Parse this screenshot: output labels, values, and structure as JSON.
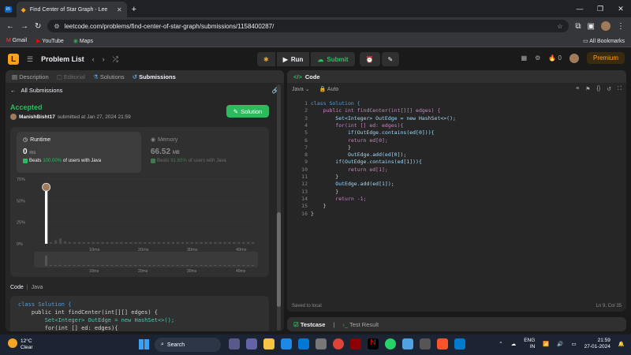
{
  "browser": {
    "tab1_icon": "linkedin-icon",
    "tab_title": "Find Center of Star Graph - Lee",
    "url": "leetcode.com/problems/find-center-of-star-graph/submissions/1158400287/",
    "bookmarks": [
      "Gmail",
      "YouTube",
      "Maps"
    ],
    "all_bookmarks": "All Bookmarks"
  },
  "header": {
    "problem_list": "Problem List",
    "run": "Run",
    "submit": "Submit",
    "streak": "0",
    "premium": "Premium"
  },
  "left": {
    "tabs": [
      "Description",
      "Editorial",
      "Solutions",
      "Submissions"
    ],
    "all_submissions": "All Submissions",
    "status": "Accepted",
    "user": "ManishBisht17",
    "submitted": "submitted at Jan 27, 2024 21:59",
    "solution_btn": "Solution",
    "runtime_label": "Runtime",
    "runtime_value": "0",
    "runtime_unit": "ms",
    "runtime_beats_pre": "Beats",
    "runtime_beats": "100.00%",
    "runtime_beats_post": "of users with Java",
    "memory_label": "Memory",
    "memory_value": "66.52",
    "memory_unit": "MB",
    "memory_beats_pre": "Beats",
    "memory_beats": "91.65%",
    "memory_beats_post": "of users with Java",
    "code_label": "Code",
    "code_lang": "Java",
    "code_lines": [
      "class Solution {",
      "    public int findCenter(int[][] edges) {",
      "        Set<Integer> OutEdge = new HashSet<>();",
      "        for(int [] ed: edges){"
    ]
  },
  "chart_data": {
    "type": "bar",
    "yticks": [
      "75%",
      "50%",
      "25%",
      "0%"
    ],
    "xticks": [
      "10ms",
      "20ms",
      "30ms",
      "40ms"
    ],
    "ylim": [
      0,
      75
    ],
    "values": [
      62,
      2,
      4,
      6,
      3,
      2,
      2,
      2,
      2,
      2,
      2,
      2,
      2,
      2,
      2,
      2,
      2,
      2,
      2,
      2,
      2,
      2,
      2,
      2,
      2,
      2,
      2,
      2,
      2,
      2,
      2,
      2,
      2,
      2,
      2,
      2,
      2,
      2,
      2,
      2,
      2,
      2,
      2,
      2,
      2
    ],
    "highlight_index": 0,
    "colors": {
      "highlight": "#ffffff",
      "bars": "#4a4a4a"
    }
  },
  "right": {
    "title": "Code",
    "lang": "Java",
    "auto": "Auto",
    "code": [
      "class Solution {",
      "    public int findCenter(int[][] edges) {",
      "        Set<Integer> OutEdge = new HashSet<>();",
      "        for(int [] ed: edges){",
      "            if(OutEdge.contains(ed[0])){",
      "            return ed[0];",
      "            }",
      "            OutEdge.add(ed[0]);",
      "        if(OutEdge.contains(ed[1])){",
      "            return ed[1];",
      "        }",
      "        OutEdge.add(ed[1]);",
      "        }",
      "        return -1;",
      "    }",
      "}"
    ],
    "saved": "Saved to local",
    "cursor": "Ln 9, Col 35",
    "testcase": "Testcase",
    "result": "Test Result"
  },
  "taskbar": {
    "temp": "12°C",
    "cond": "Clear",
    "search": "Search",
    "lang1": "ENG",
    "lang2": "IN",
    "time": "21:59",
    "date": "27-01-2024"
  }
}
